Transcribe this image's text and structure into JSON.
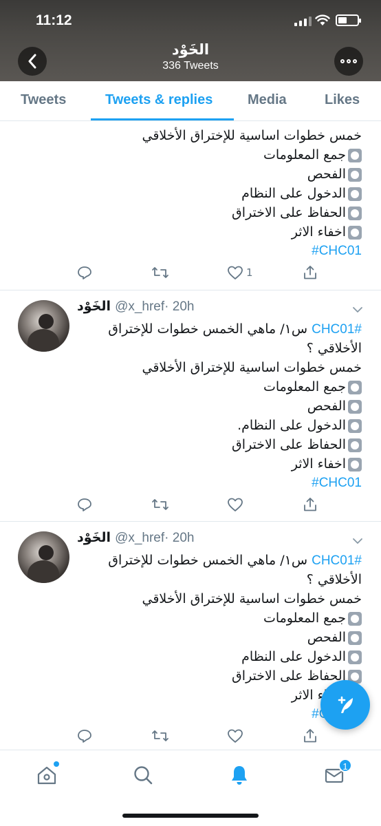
{
  "status_bar": {
    "time": "11:12"
  },
  "header": {
    "title": "الخَوْد",
    "tweet_count": "336 Tweets"
  },
  "tabs": [
    {
      "label": "Tweets"
    },
    {
      "label": "Tweets & replies"
    },
    {
      "label": "Media"
    },
    {
      "label": "Likes"
    }
  ],
  "tweets": [
    {
      "lines": [
        "خمس خطوات اساسية للإختراق الأخلاقي",
        "جمع المعلومات",
        "الفحص",
        "الدخول على النظام",
        "الحفاظ على الاختراق",
        "اخفاء الاثر"
      ],
      "hashtag": "#CHC01",
      "like_count": "1"
    },
    {
      "name": "الخَوْد",
      "handle": "@x_href",
      "time": "· 20h",
      "first_hashtag": "#CHC01",
      "first_line_rest": "س١/ ماهي الخمس خطوات للإختراق",
      "second_line": "الأخلاقي ؟",
      "lines": [
        "خمس خطوات اساسية للإختراق الأخلاقي",
        "جمع المعلومات",
        "الفحص",
        "الدخول على النظام.",
        "الحفاظ على الاختراق",
        "اخفاء الاثر"
      ],
      "hashtag": "#CHC01"
    },
    {
      "name": "الخَوْد",
      "handle": "@x_href",
      "time": "· 20h",
      "first_hashtag": "#CHC01",
      "first_line_rest": "س١/ ماهي الخمس خطوات للإختراق",
      "second_line": "الأخلاقي ؟",
      "lines": [
        "خمس خطوات اساسية للإختراق الأخلاقي",
        "جمع المعلومات",
        "الفحص",
        "الدخول على النظام",
        "الحفاظ على الاختراق",
        "اخفاء الاثر"
      ],
      "hashtag": "#CHC01"
    }
  ],
  "bottom_nav": {
    "messages_badge": "1"
  },
  "colors": {
    "accent": "#1da1f2",
    "secondary_text": "#657786",
    "divider": "#e1e8ed"
  }
}
